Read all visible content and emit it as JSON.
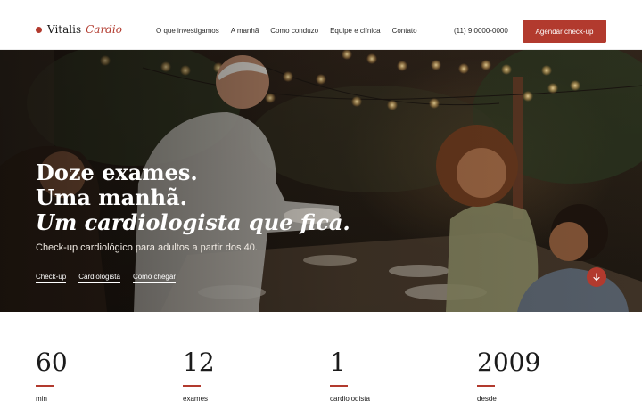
{
  "brand": {
    "name": "Vitalis",
    "suffix": "Cardio"
  },
  "nav": {
    "items": [
      {
        "label": "O que investigamos"
      },
      {
        "label": "A manhã"
      },
      {
        "label": "Como conduzo"
      },
      {
        "label": "Equipe e clínica"
      },
      {
        "label": "Contato"
      }
    ]
  },
  "header": {
    "phone": "(11) 9 0000-0000",
    "cta_label": "Agendar check-up"
  },
  "hero": {
    "title_line1": "Doze exames.",
    "title_line2": "Uma manhã.",
    "title_line3": "Um cardiologista que fica.",
    "subtitle": "Check-up cardiológico para adultos a partir dos 40.",
    "links": [
      "Check-up",
      "Cardiologista",
      "Como chegar"
    ],
    "scroll_icon": "arrow-down-icon"
  },
  "stats": [
    {
      "value": "60",
      "label": "min"
    },
    {
      "value": "12",
      "label": "exames"
    },
    {
      "value": "1",
      "label": "cardiologista"
    },
    {
      "value": "2009",
      "label": "desde"
    }
  ],
  "colors": {
    "accent": "#b23a2e",
    "text": "#1b1b1b"
  }
}
